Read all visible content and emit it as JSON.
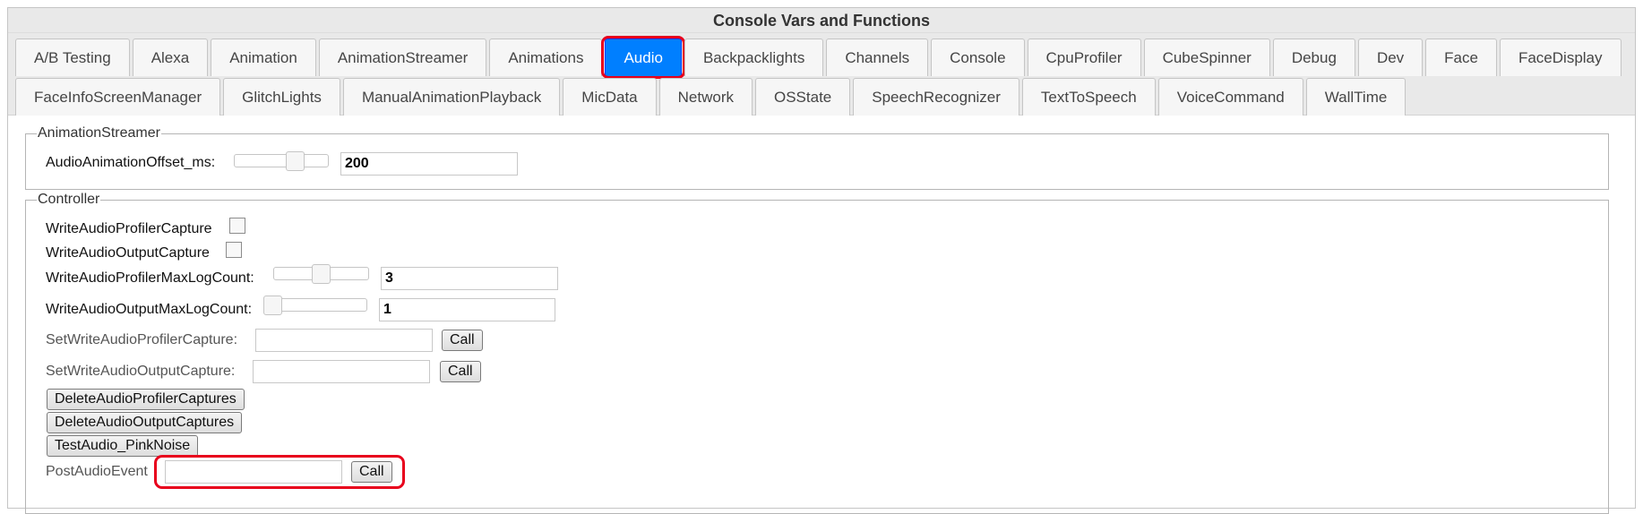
{
  "window": {
    "title": "Console Vars and Functions"
  },
  "tabs": {
    "row1": [
      "A/B Testing",
      "Alexa",
      "Animation",
      "AnimationStreamer",
      "Animations",
      "Audio",
      "Backpacklights",
      "Channels",
      "Console",
      "CpuProfiler",
      "CubeSpinner",
      "Debug",
      "Dev",
      "Face",
      "FaceDisplay"
    ],
    "row2": [
      "FaceInfoScreenManager",
      "GlitchLights",
      "ManualAnimationPlayback",
      "MicData",
      "Network",
      "OSState",
      "SpeechRecognizer",
      "TextToSpeech",
      "VoiceCommand",
      "WallTime"
    ],
    "active": "Audio"
  },
  "animation_streamer": {
    "legend": "AnimationStreamer",
    "offset_label": "AudioAnimationOffset_ms:",
    "offset_value": "200"
  },
  "controller": {
    "legend": "Controller",
    "profiler_capture_label": "WriteAudioProfilerCapture",
    "output_capture_label": "WriteAudioOutputCapture",
    "profiler_max_label": "WriteAudioProfilerMaxLogCount:",
    "profiler_max_value": "3",
    "output_max_label": "WriteAudioOutputMaxLogCount:",
    "output_max_value": "1",
    "set_profiler_label": "SetWriteAudioProfilerCapture:",
    "set_output_label": "SetWriteAudioOutputCapture:",
    "call_label": "Call",
    "delete_profiler_label": "DeleteAudioProfilerCaptures",
    "delete_output_label": "DeleteAudioOutputCaptures",
    "test_audio_label": "TestAudio_PinkNoise",
    "post_event_label": "PostAudioEvent"
  },
  "colors": {
    "accent": "#007fff",
    "highlight": "#e8001c"
  }
}
